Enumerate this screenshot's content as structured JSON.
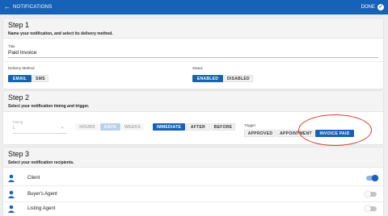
{
  "header": {
    "title": "NOTIFICATIONS",
    "done_label": "DONE"
  },
  "step1": {
    "title": "Step 1",
    "description": "Name your notification, and select its delivery method.",
    "title_label": "Title",
    "title_value": "Paid Invoice",
    "delivery_label": "Delivery Method",
    "delivery_options": [
      "EMAIL",
      "SMS"
    ],
    "delivery_selected": "EMAIL",
    "status_label": "Status",
    "status_options": [
      "ENABLED",
      "DISABLED"
    ],
    "status_selected": "ENABLED"
  },
  "step2": {
    "title": "Step 2",
    "description": "Select your notification timing and trigger.",
    "timing_label": "Timing",
    "timing_value": "1",
    "units": [
      "HOURS",
      "DAYS",
      "WEEKS"
    ],
    "unit_selected": "DAYS",
    "relation": [
      "IMMEDIATE",
      "AFTER",
      "BEFORE"
    ],
    "relation_selected": "IMMEDIATE",
    "trigger_label": "Trigger",
    "triggers": [
      "APPROVED",
      "APPOINTMENT",
      "INVOICE PAID"
    ],
    "trigger_selected": "INVOICE PAID"
  },
  "step3": {
    "title": "Step 3",
    "description": "Select your notification recipients.",
    "recipients": [
      {
        "name": "Client",
        "enabled": true
      },
      {
        "name": "Buyer's Agent",
        "enabled": false
      },
      {
        "name": "Listing Agent",
        "enabled": false
      }
    ]
  },
  "colors": {
    "primary": "#1662b8",
    "annotation": "#d23a2a"
  },
  "icons": {
    "back": "arrow-left-icon",
    "done": "check-circle-icon",
    "recipient": "person-icon"
  }
}
